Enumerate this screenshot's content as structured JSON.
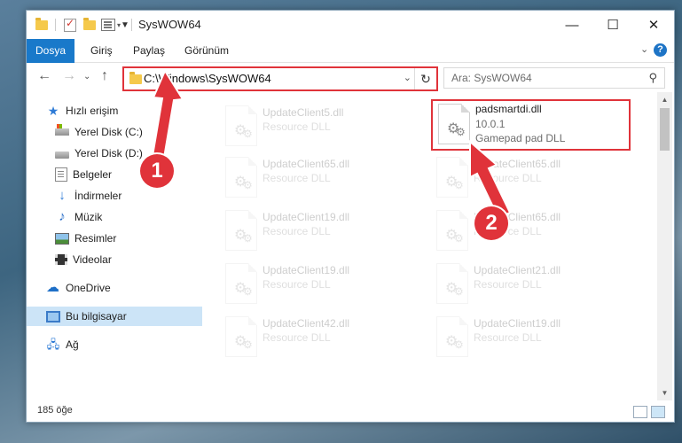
{
  "window": {
    "title": "SysWOW64"
  },
  "ribbon": {
    "tabs": [
      "Dosya",
      "Giriş",
      "Paylaş",
      "Görünüm"
    ]
  },
  "address": {
    "path": "C:\\Windows\\SysWOW64"
  },
  "search": {
    "placeholder": "Ara: SysWOW64"
  },
  "sidebar": {
    "items": [
      {
        "label": "Hızlı erişim",
        "icon": "star-icon"
      },
      {
        "label": "Yerel Disk (C:)",
        "icon": "disk-icon",
        "pinned": true
      },
      {
        "label": "Yerel Disk (D:)",
        "icon": "disk-icon",
        "pinned": true
      },
      {
        "label": "Belgeler",
        "icon": "document-icon",
        "pinned": true
      },
      {
        "label": "İndirmeler",
        "icon": "download-icon",
        "pinned": true
      },
      {
        "label": "Müzik",
        "icon": "music-icon",
        "pinned": true
      },
      {
        "label": "Resimler",
        "icon": "picture-icon",
        "pinned": true
      },
      {
        "label": "Videolar",
        "icon": "video-icon",
        "pinned": true
      },
      {
        "label": "OneDrive",
        "icon": "cloud-icon"
      },
      {
        "label": "Bu bilgisayar",
        "icon": "computer-icon",
        "selected": true
      },
      {
        "label": "Ağ",
        "icon": "network-icon"
      }
    ]
  },
  "files": [
    {
      "name": "UpdateClient5.dll",
      "desc": "Resource DLL",
      "faded": true
    },
    {
      "name": "padsmartdi.dll",
      "version": "10.0.1",
      "desc": "Gamepad pad DLL",
      "highlighted": true
    },
    {
      "name": "UpdateClient65.dll",
      "desc": "Resource DLL",
      "faded": true
    },
    {
      "name": "UpdateClient65.dll",
      "desc": "Resource DLL",
      "faded": true
    },
    {
      "name": "UpdateClient19.dll",
      "desc": "Resource DLL",
      "faded": true
    },
    {
      "name": "UpdateClient65.dll",
      "desc": "Resource DLL",
      "faded": true
    },
    {
      "name": "UpdateClient19.dll",
      "desc": "Resource DLL",
      "faded": true
    },
    {
      "name": "UpdateClient21.dll",
      "desc": "Resource DLL",
      "faded": true
    },
    {
      "name": "UpdateClient42.dll",
      "desc": "Resource DLL",
      "faded": true
    },
    {
      "name": "UpdateClient19.dll",
      "desc": "Resource DLL",
      "faded": true
    }
  ],
  "status": {
    "count": "185 öğe"
  },
  "annotations": [
    {
      "number": "1",
      "color": "#e0333a"
    },
    {
      "number": "2",
      "color": "#e0333a"
    }
  ],
  "colors": {
    "accent": "#1979ca",
    "highlight": "#e0333a",
    "selected": "#cce4f7"
  }
}
